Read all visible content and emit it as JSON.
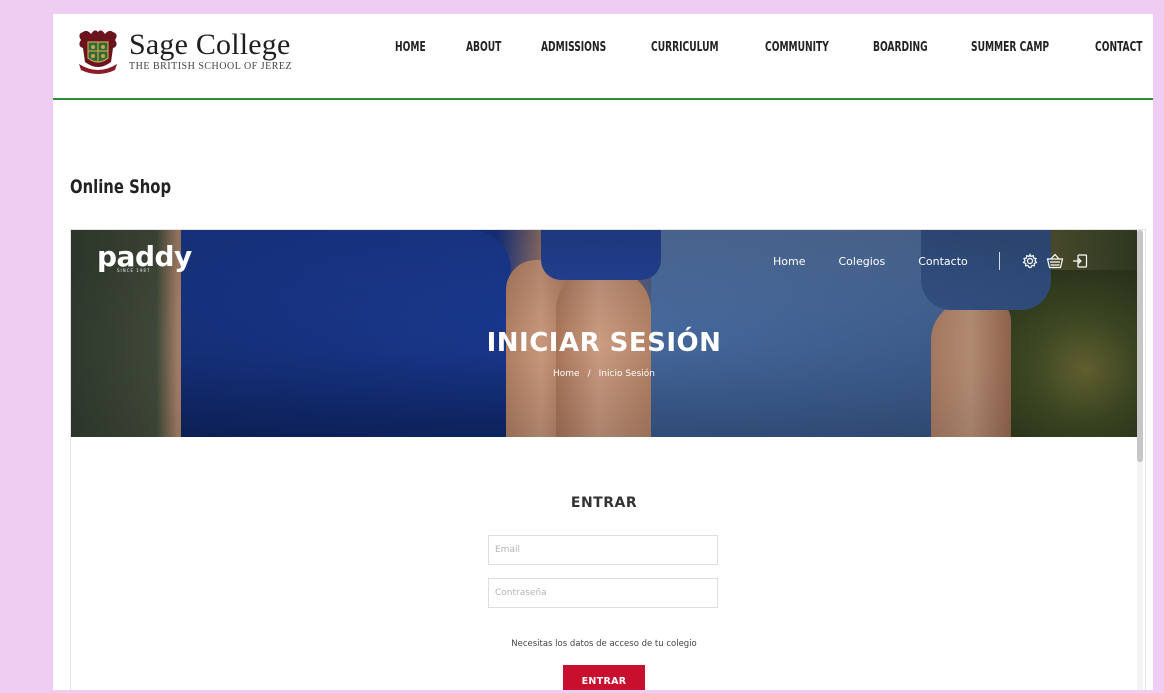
{
  "site": {
    "logo_title": "Sage College",
    "logo_subtitle": "THE BRITISH SCHOOL OF JEREZ",
    "nav": [
      "HOME",
      "ABOUT",
      "ADMISSIONS",
      "CURRICULUM",
      "COMMUNITY",
      "BOARDING",
      "SUMMER CAMP",
      "CONTACT"
    ],
    "accent_color": "#2e8b3a"
  },
  "page_title": "Online Shop",
  "shop": {
    "logo": "paddy",
    "logo_tagline": "SINCE 1987",
    "nav": [
      "Home",
      "Colegios",
      "Contacto"
    ],
    "icons": [
      "settings-gear-icon",
      "basket-icon",
      "login-icon"
    ],
    "hero_title": "INICIAR SESIÓN",
    "breadcrumb": {
      "home": "Home",
      "separator": "/",
      "current": "Inicio Sesión"
    },
    "login": {
      "title": "ENTRAR",
      "email_placeholder": "Email",
      "password_placeholder": "Contraseña",
      "help_text": "Necesitas los datos de acceso de tu colegio",
      "submit_label": "ENTRAR",
      "button_color": "#c8102e"
    }
  }
}
